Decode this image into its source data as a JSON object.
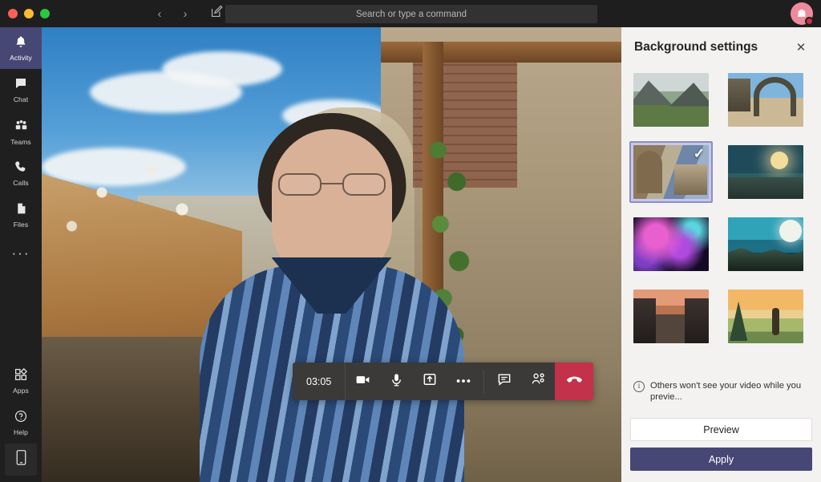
{
  "titlebar": {
    "window_controls": [
      "close",
      "minimize",
      "maximize"
    ],
    "back_label": "‹",
    "forward_label": "›",
    "compose_icon": "compose-icon",
    "avatar_glyph": "☗"
  },
  "search": {
    "placeholder": "Search or type a command",
    "value": ""
  },
  "sidebar": {
    "items": [
      {
        "label": "Activity",
        "icon": "bell-icon",
        "selected": true
      },
      {
        "label": "Chat",
        "icon": "chat-bubble-icon",
        "selected": false
      },
      {
        "label": "Teams",
        "icon": "people-icon",
        "selected": false
      },
      {
        "label": "Calls",
        "icon": "phone-icon",
        "selected": false
      },
      {
        "label": "Files",
        "icon": "file-icon",
        "selected": false
      }
    ],
    "more_label": "···",
    "bottom_items": [
      {
        "label": "Apps",
        "icon": "apps-grid-icon"
      },
      {
        "label": "Help",
        "icon": "help-circle-icon"
      }
    ],
    "download_app_icon": "mobile-phone-icon"
  },
  "callbar": {
    "timer": "03:05",
    "buttons": [
      {
        "name": "camera-toggle",
        "icon": "video-camera-icon"
      },
      {
        "name": "mic-toggle",
        "icon": "microphone-icon"
      },
      {
        "name": "share-screen",
        "icon": "share-screen-icon"
      },
      {
        "name": "more-actions",
        "icon": "ellipsis-icon"
      },
      {
        "name": "show-conversation",
        "icon": "chat-bubble-icon"
      },
      {
        "name": "show-participants",
        "icon": "participants-icon"
      }
    ],
    "hangup": {
      "name": "hang-up",
      "icon": "phone-hangup-icon"
    }
  },
  "panel": {
    "title": "Background settings",
    "close_label": "✕",
    "backgrounds": [
      {
        "name": "mountain-valley",
        "art": "t-valley",
        "selected": false
      },
      {
        "name": "stone-archway-village",
        "art": "t-arch",
        "selected": false
      },
      {
        "name": "medieval-village-alley",
        "art": "t-village",
        "selected": true
      },
      {
        "name": "night-harbor-moon",
        "art": "t-night",
        "selected": false
      },
      {
        "name": "pink-nebula-space",
        "art": "t-nebula",
        "selected": false
      },
      {
        "name": "moonlit-cliffs",
        "art": "t-cliff",
        "selected": false
      },
      {
        "name": "autumn-street",
        "art": "t-street",
        "selected": false
      },
      {
        "name": "sunset-valley",
        "art": "t-sunset",
        "selected": false
      }
    ],
    "selected_check": "✓",
    "notice": {
      "icon_label": "i",
      "text": "Others won't see your video while you previe..."
    },
    "preview_label": "Preview",
    "apply_label": "Apply"
  },
  "colors": {
    "accent_purple": "#464775",
    "hangup_red": "#c4314b",
    "panel_bg": "#f3f2f1",
    "rail_bg": "#201f1f",
    "titlebar_bg": "#1f1e1e"
  }
}
